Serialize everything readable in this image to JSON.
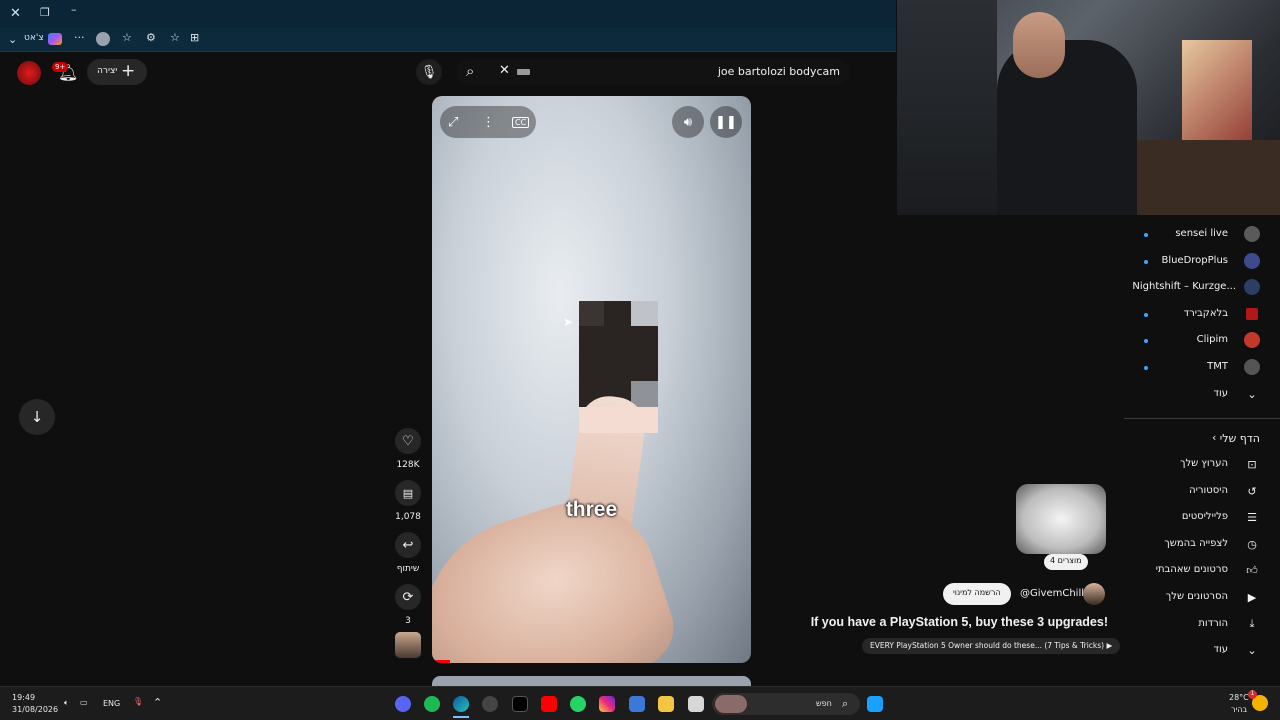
{
  "browser": {
    "tab_label": "צ'אט",
    "colors": {
      "chrome": "#0b2536"
    }
  },
  "header": {
    "create_label": "יצירה",
    "notification_count": "9+",
    "search_query": "joe bartolozi bodycam"
  },
  "video": {
    "caption": "three",
    "controls": [
      "fullscreen-icon",
      "more-vert-icon",
      "cc-icon",
      "volume-icon",
      "pause-icon"
    ]
  },
  "actions": {
    "likes": "128K",
    "comments": "1,078",
    "share_label": "שיתוף",
    "remix_count": "3"
  },
  "channel": {
    "handle": "@GivemChills",
    "subscribe_label": "הרשמה למינוי",
    "title": "If you have a PlayStation 5, buy these 3 upgrades!",
    "related_label": "EVERY PlayStation 5 Owner should do these... (7 Tips & Tricks)",
    "products_label": "4 מוצרים"
  },
  "subscriptions": [
    {
      "name": "sensei live",
      "icon": "avatar"
    },
    {
      "name": "BlueDropPlus",
      "icon": "avatar"
    },
    {
      "name": "Nightshift – Kurzge...",
      "icon": "avatar"
    },
    {
      "name": "בלאקבירד",
      "icon": "avatar"
    },
    {
      "name": "Clipim",
      "icon": "avatar"
    },
    {
      "name": "TMT",
      "icon": "avatar"
    }
  ],
  "sub_more_label": "עוד",
  "you_section": {
    "title": "הדף שלי",
    "items": [
      {
        "label": "הערוץ שלך",
        "icon": "person-box-icon"
      },
      {
        "label": "היסטוריה",
        "icon": "history-icon"
      },
      {
        "label": "פלייליסטים",
        "icon": "playlist-icon"
      },
      {
        "label": "לצפייה בהמשך",
        "icon": "clock-icon"
      },
      {
        "label": "סרטונים שאהבתי",
        "icon": "thumb-up-icon"
      },
      {
        "label": "הסרטונים שלך",
        "icon": "video-icon"
      },
      {
        "label": "הורדות",
        "icon": "download-icon"
      },
      {
        "label": "עוד",
        "icon": "chevron-down-icon"
      }
    ]
  },
  "taskbar": {
    "time": "19:49",
    "date": "31/08/2026",
    "lang": "ENG",
    "search_label": "חפש",
    "weather_temp": "28°C",
    "weather_desc": "בהיר",
    "weather_badge": "1"
  }
}
